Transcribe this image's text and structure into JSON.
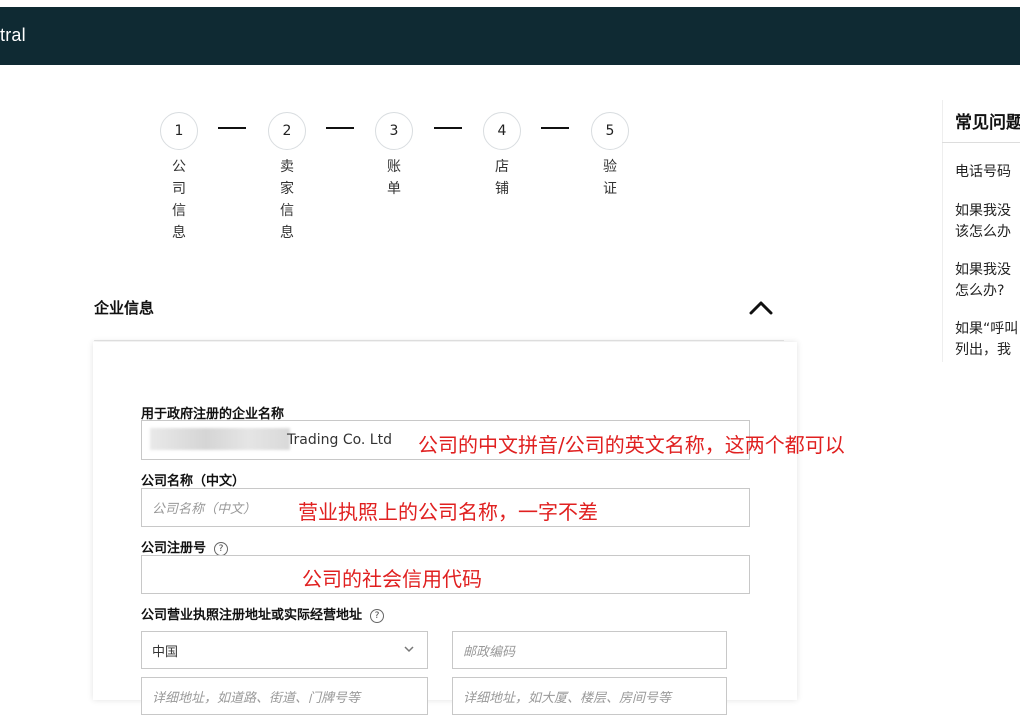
{
  "header": {
    "brand": "tral"
  },
  "steps": [
    {
      "num": "1",
      "label": [
        "公",
        "司",
        "信",
        "息"
      ]
    },
    {
      "num": "2",
      "label": [
        "卖",
        "家",
        "信",
        "息"
      ]
    },
    {
      "num": "3",
      "label": [
        "账",
        "单"
      ]
    },
    {
      "num": "4",
      "label": [
        "店",
        "铺"
      ]
    },
    {
      "num": "5",
      "label": [
        "验",
        "证"
      ]
    }
  ],
  "section": {
    "title": "企业信息"
  },
  "form": {
    "company_name_label": "用于政府注册的企业名称",
    "company_name_value": "Trading Co. Ltd",
    "company_cn_label": "公司名称（中文）",
    "company_cn_placeholder": "公司名称（中文）",
    "reg_no_label": "公司注册号",
    "address_label": "公司营业执照注册地址或实际经营地址",
    "country_value": "中国",
    "postal_placeholder": "邮政编码",
    "address1_placeholder": "详细地址，如道路、街道、门牌号等",
    "address2_placeholder": "详细地址，如大厦、楼层、房间号等"
  },
  "annotations": {
    "company_name": "公司的中文拼音/公司的英文名称，这两个都可以",
    "company_cn": "营业执照上的公司名称，一字不差",
    "reg_no": "公司的社会信用代码"
  },
  "faq": {
    "title": "常见问题",
    "items": [
      "电话号码",
      "如果我没",
      "该怎么办",
      "如果我没",
      "怎么办?",
      "如果“呼叫",
      "列出，我"
    ]
  },
  "colors": {
    "topbar": "#0f2a33",
    "annotation": "#e02020"
  }
}
